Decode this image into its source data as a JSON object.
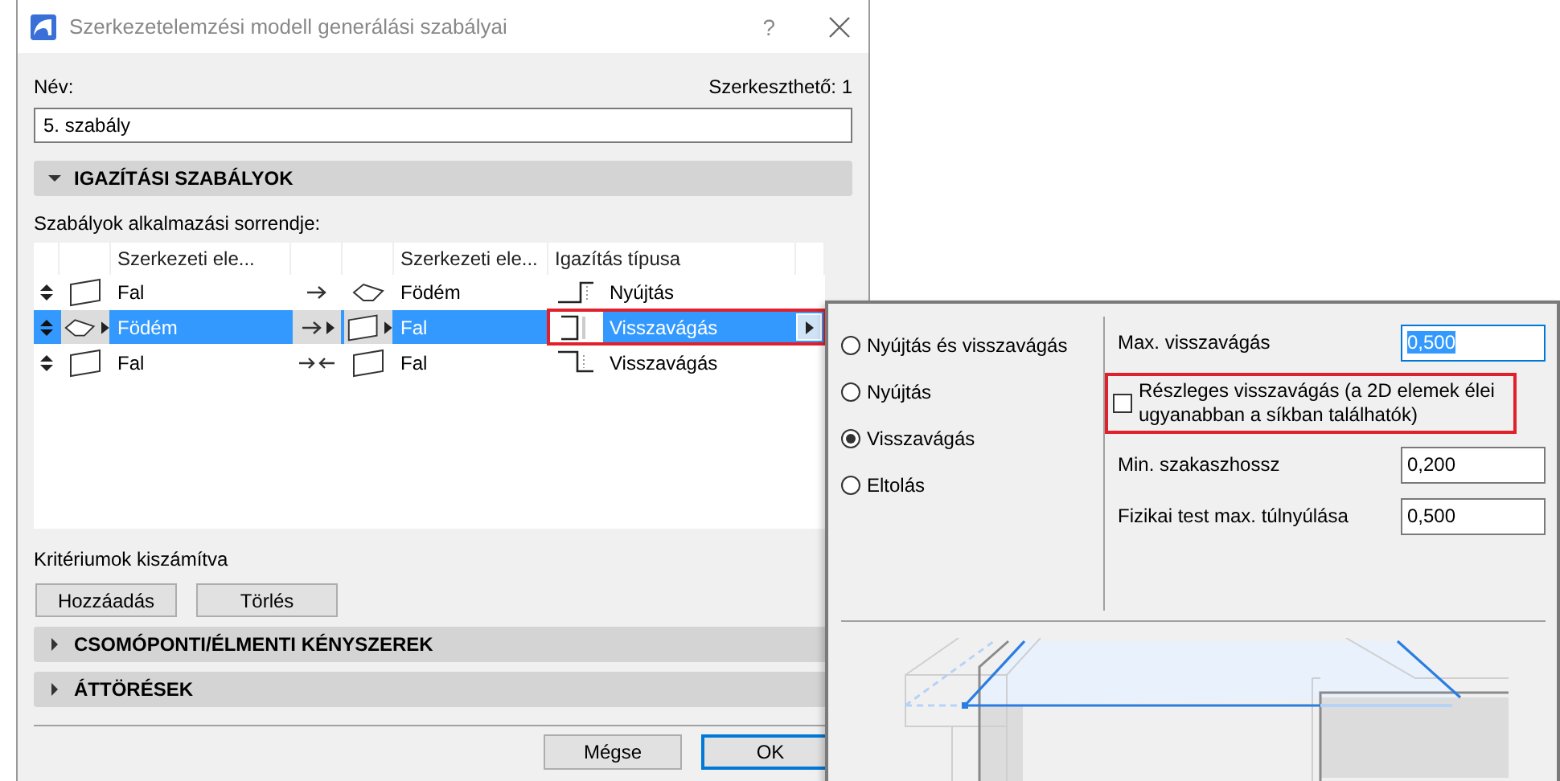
{
  "window": {
    "title": "Szerkezetelemzési modell generálási szabályai",
    "help": "?"
  },
  "name_label": "Név:",
  "editable": "Szerkeszthető: 1",
  "name_value": "5. szabály",
  "alignment_section": {
    "title": "IGAZÍTÁSI SZABÁLYOK",
    "expanded": true
  },
  "order_label": "Szabályok alkalmazási sorrendje:",
  "table": {
    "columns": [
      {
        "label": "Szerkezeti ele..."
      },
      {
        "label": "Szerkezeti ele..."
      },
      {
        "label": "Igazítás típusa"
      }
    ],
    "rows": [
      {
        "element_1": {
          "label": "Fal",
          "kind": "wall"
        },
        "relation": {
          "kind": "to"
        },
        "element_2": {
          "label": "Födém",
          "kind": "slab"
        },
        "alignment": {
          "label": "Nyújtás",
          "kind": "extend"
        },
        "selected": false,
        "highlighted": false
      },
      {
        "element_1": {
          "label": "Födém",
          "kind": "slab"
        },
        "relation": {
          "kind": "to"
        },
        "element_2": {
          "label": "Fal",
          "kind": "wall"
        },
        "alignment": {
          "label": "Visszavágás",
          "kind": "trim"
        },
        "selected": true,
        "highlighted": true
      },
      {
        "element_1": {
          "label": "Fal",
          "kind": "wall"
        },
        "relation": {
          "kind": "meet"
        },
        "element_2": {
          "label": "Fal",
          "kind": "wall"
        },
        "alignment": {
          "label": "Visszavágás",
          "kind": "step"
        },
        "selected": false,
        "highlighted": false
      }
    ]
  },
  "status": "Kritériumok kiszámítva",
  "buttons": [
    "Hozzáadás",
    "Törlés"
  ],
  "other_sections": [
    {
      "title": "CSOMÓPONTI/ÉLMENTI KÉNYSZEREK",
      "expanded": false
    },
    {
      "title": "ÁTTÖRÉSEK",
      "expanded": false
    }
  ],
  "footer_buttons": [
    {
      "label": "Mégse",
      "default": false
    },
    {
      "label": "OK",
      "default": true
    }
  ],
  "popup": {
    "options": [
      {
        "label": "Nyújtás és visszavágás",
        "selected": false
      },
      {
        "label": "Nyújtás",
        "selected": false
      },
      {
        "label": "Visszavágás",
        "selected": true
      },
      {
        "label": "Eltolás",
        "selected": false
      }
    ],
    "fields": [
      {
        "kind": "field",
        "label": "Max. visszavágás",
        "value": "0,500",
        "focused": true
      },
      {
        "kind": "checkbox",
        "label": "Részleges visszavágás (a 2D elemek élei ugyanabban a síkban találhatók)",
        "checked": false,
        "highlighted": true
      },
      {
        "kind": "field",
        "label": "Min. szakaszhossz",
        "value": "0,200",
        "focused": false
      },
      {
        "kind": "field",
        "label": "Fizikai test max. túlnyúlása",
        "value": "0,500",
        "focused": false
      }
    ]
  }
}
